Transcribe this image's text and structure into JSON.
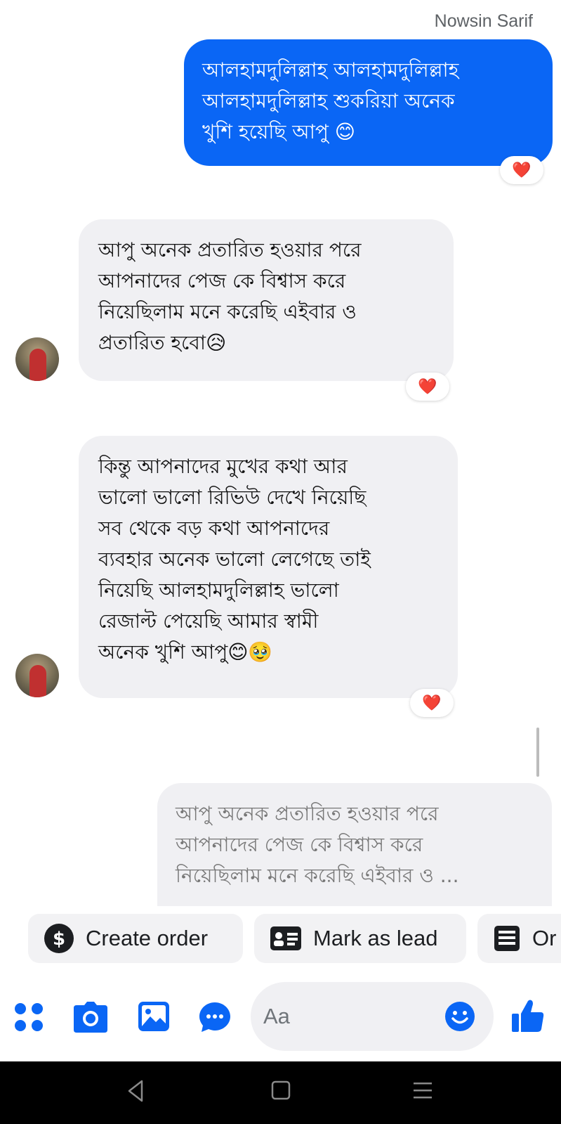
{
  "chat": {
    "sender_name": "Nowsin Sarif",
    "messages": [
      {
        "direction": "outgoing",
        "text": "আলহামদুলিল্লাহ আলহামদুলিল্লাহ\nআলহামদুলিল্লাহ শুকরিয়া অনেক\nখুশি হয়েছি আপু 😊",
        "reaction": "❤️"
      },
      {
        "direction": "incoming",
        "text": "আপু অনেক প্রতারিত হওয়ার পরে\nআপনাদের পেজ কে বিশ্বাস করে\nনিয়েছিলাম মনে করেছি এইবার ও\nপ্রতারিত হবো😥",
        "reaction": "❤️"
      },
      {
        "direction": "incoming",
        "text": "কিন্তু আপনাদের মুখের কথা আর\nভালো ভালো রিভিউ দেখে নিয়েছি\nসব থেকে বড় কথা আপনাদের\nব্যবহার অনেক ভালো লেগেছে তাই\nনিয়েছি আলহামদুলিল্লাহ ভালো\nরেজাল্ট পেয়েছি আমার স্বামী\nঅনেক খুশি আপু😊🥹",
        "reaction": "❤️"
      }
    ],
    "quoted_reply": "আপু অনেক প্রতারিত হওয়ার পরে\nআপনাদের পেজ কে বিশ্বাস করে\nনিয়েছিলাম মনে করেছি এইবার ও ..."
  },
  "actions": {
    "create_order": "Create order",
    "mark_as_lead": "Mark as lead",
    "third_partial": "Or"
  },
  "composer": {
    "placeholder": "Aa",
    "icons": [
      "apps-icon",
      "camera-icon",
      "gallery-icon",
      "chat-bubble-icon",
      "emoji-icon",
      "like-icon"
    ]
  },
  "colors": {
    "accent": "#0a66f5",
    "incoming_bubble": "#f0f0f3",
    "reaction_heart": "#e0173c"
  }
}
